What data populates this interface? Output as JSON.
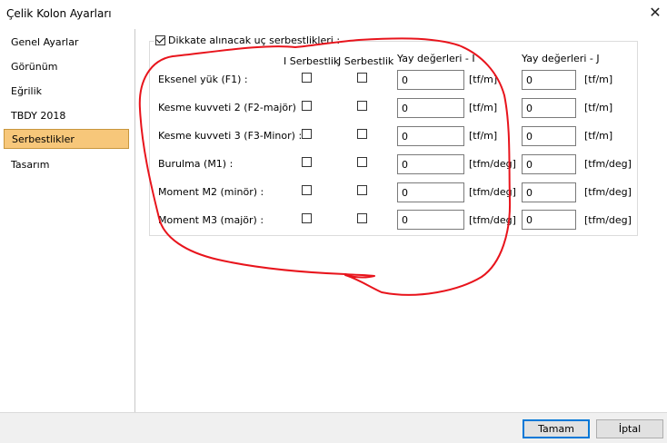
{
  "window": {
    "title": "Çelik Kolon Ayarları",
    "close_glyph": "✕",
    "close_icon": "close-icon"
  },
  "sidebar": {
    "items": [
      {
        "label": "Genel Ayarlar",
        "selected": false
      },
      {
        "label": "Görünüm",
        "selected": false
      },
      {
        "label": "Eğrilik",
        "selected": false
      },
      {
        "label": "TBDY 2018",
        "selected": false
      },
      {
        "label": "Serbestlikler",
        "selected": true
      },
      {
        "label": "Tasarım",
        "selected": false
      }
    ]
  },
  "group": {
    "title": "Dikkate alınacak uç serbestlikleri :",
    "checked": true,
    "headers": {
      "i_release": "I Serbestlik",
      "j_release": "J Serbestlik",
      "spring_i": "Yay değerleri - I",
      "spring_j": "Yay değerleri - J"
    },
    "rows": [
      {
        "label": "Eksenel yük (F1) :",
        "i_checked": false,
        "j_checked": false,
        "spring_i": "0",
        "unit_i": "[tf/m]",
        "spring_j": "0",
        "unit_j": "[tf/m]"
      },
      {
        "label": "Kesme kuvveti 2 (F2-majör)",
        "i_checked": false,
        "j_checked": false,
        "spring_i": "0",
        "unit_i": "[tf/m]",
        "spring_j": "0",
        "unit_j": "[tf/m]"
      },
      {
        "label": "Kesme kuvveti 3 (F3-Minor) :",
        "i_checked": false,
        "j_checked": false,
        "spring_i": "0",
        "unit_i": "[tf/m]",
        "spring_j": "0",
        "unit_j": "[tf/m]"
      },
      {
        "label": "Burulma (M1) :",
        "i_checked": false,
        "j_checked": false,
        "spring_i": "0",
        "unit_i": "[tfm/deg]",
        "spring_j": "0",
        "unit_j": "[tfm/deg]"
      },
      {
        "label": "Moment M2 (minör) :",
        "i_checked": false,
        "j_checked": false,
        "spring_i": "0",
        "unit_i": "[tfm/deg]",
        "spring_j": "0",
        "unit_j": "[tfm/deg]"
      },
      {
        "label": "Moment M3 (majör) :",
        "i_checked": false,
        "j_checked": false,
        "spring_i": "0",
        "unit_i": "[tfm/deg]",
        "spring_j": "0",
        "unit_j": "[tfm/deg]"
      }
    ]
  },
  "buttons": {
    "ok": "Tamam",
    "cancel": "İptal"
  },
  "annotation": {
    "color": "#e8141c"
  }
}
